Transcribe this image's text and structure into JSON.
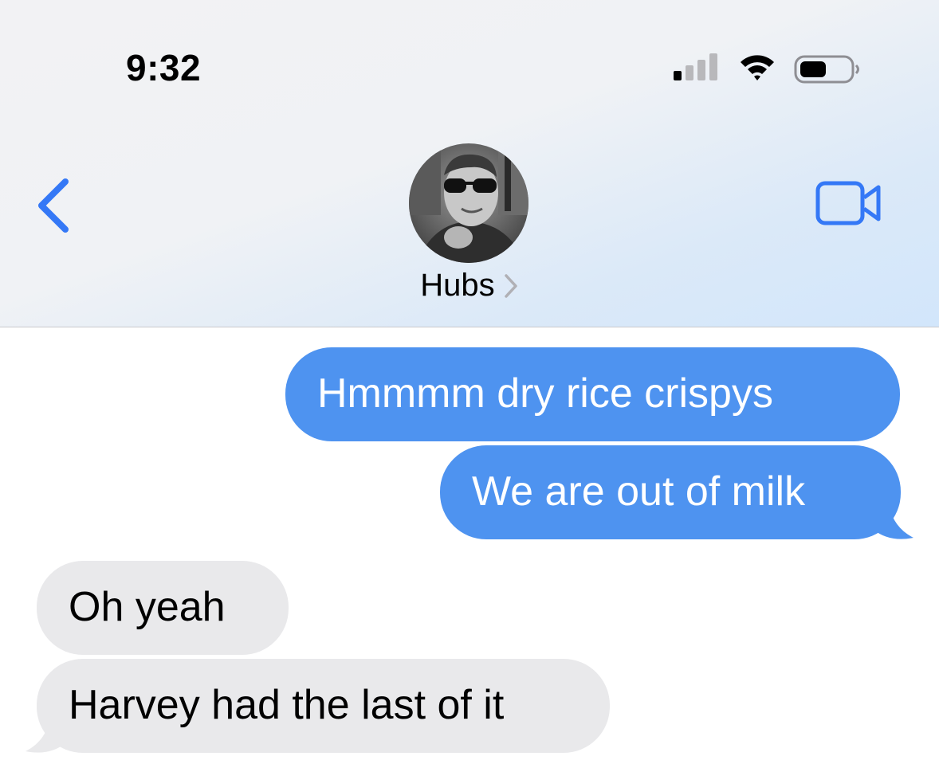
{
  "status_bar": {
    "time": "9:32",
    "icons": [
      "signal-icon",
      "wifi-icon",
      "battery-icon"
    ]
  },
  "nav": {
    "back_icon": "chevron-left-icon",
    "contact_name": "Hubs",
    "contact_chevron_icon": "chevron-right-icon",
    "video_icon": "video-camera-icon"
  },
  "messages": [
    {
      "direction": "sent",
      "text": "Hmmmm dry rice crispys"
    },
    {
      "direction": "sent",
      "text": "We are out of milk"
    },
    {
      "direction": "received",
      "text": "Oh yeah"
    },
    {
      "direction": "received",
      "text": "Harvey had the last of it"
    }
  ],
  "colors": {
    "accent": "#3478f6",
    "sent_bubble": "#4e93f0",
    "received_bubble": "#e9e9eb"
  }
}
